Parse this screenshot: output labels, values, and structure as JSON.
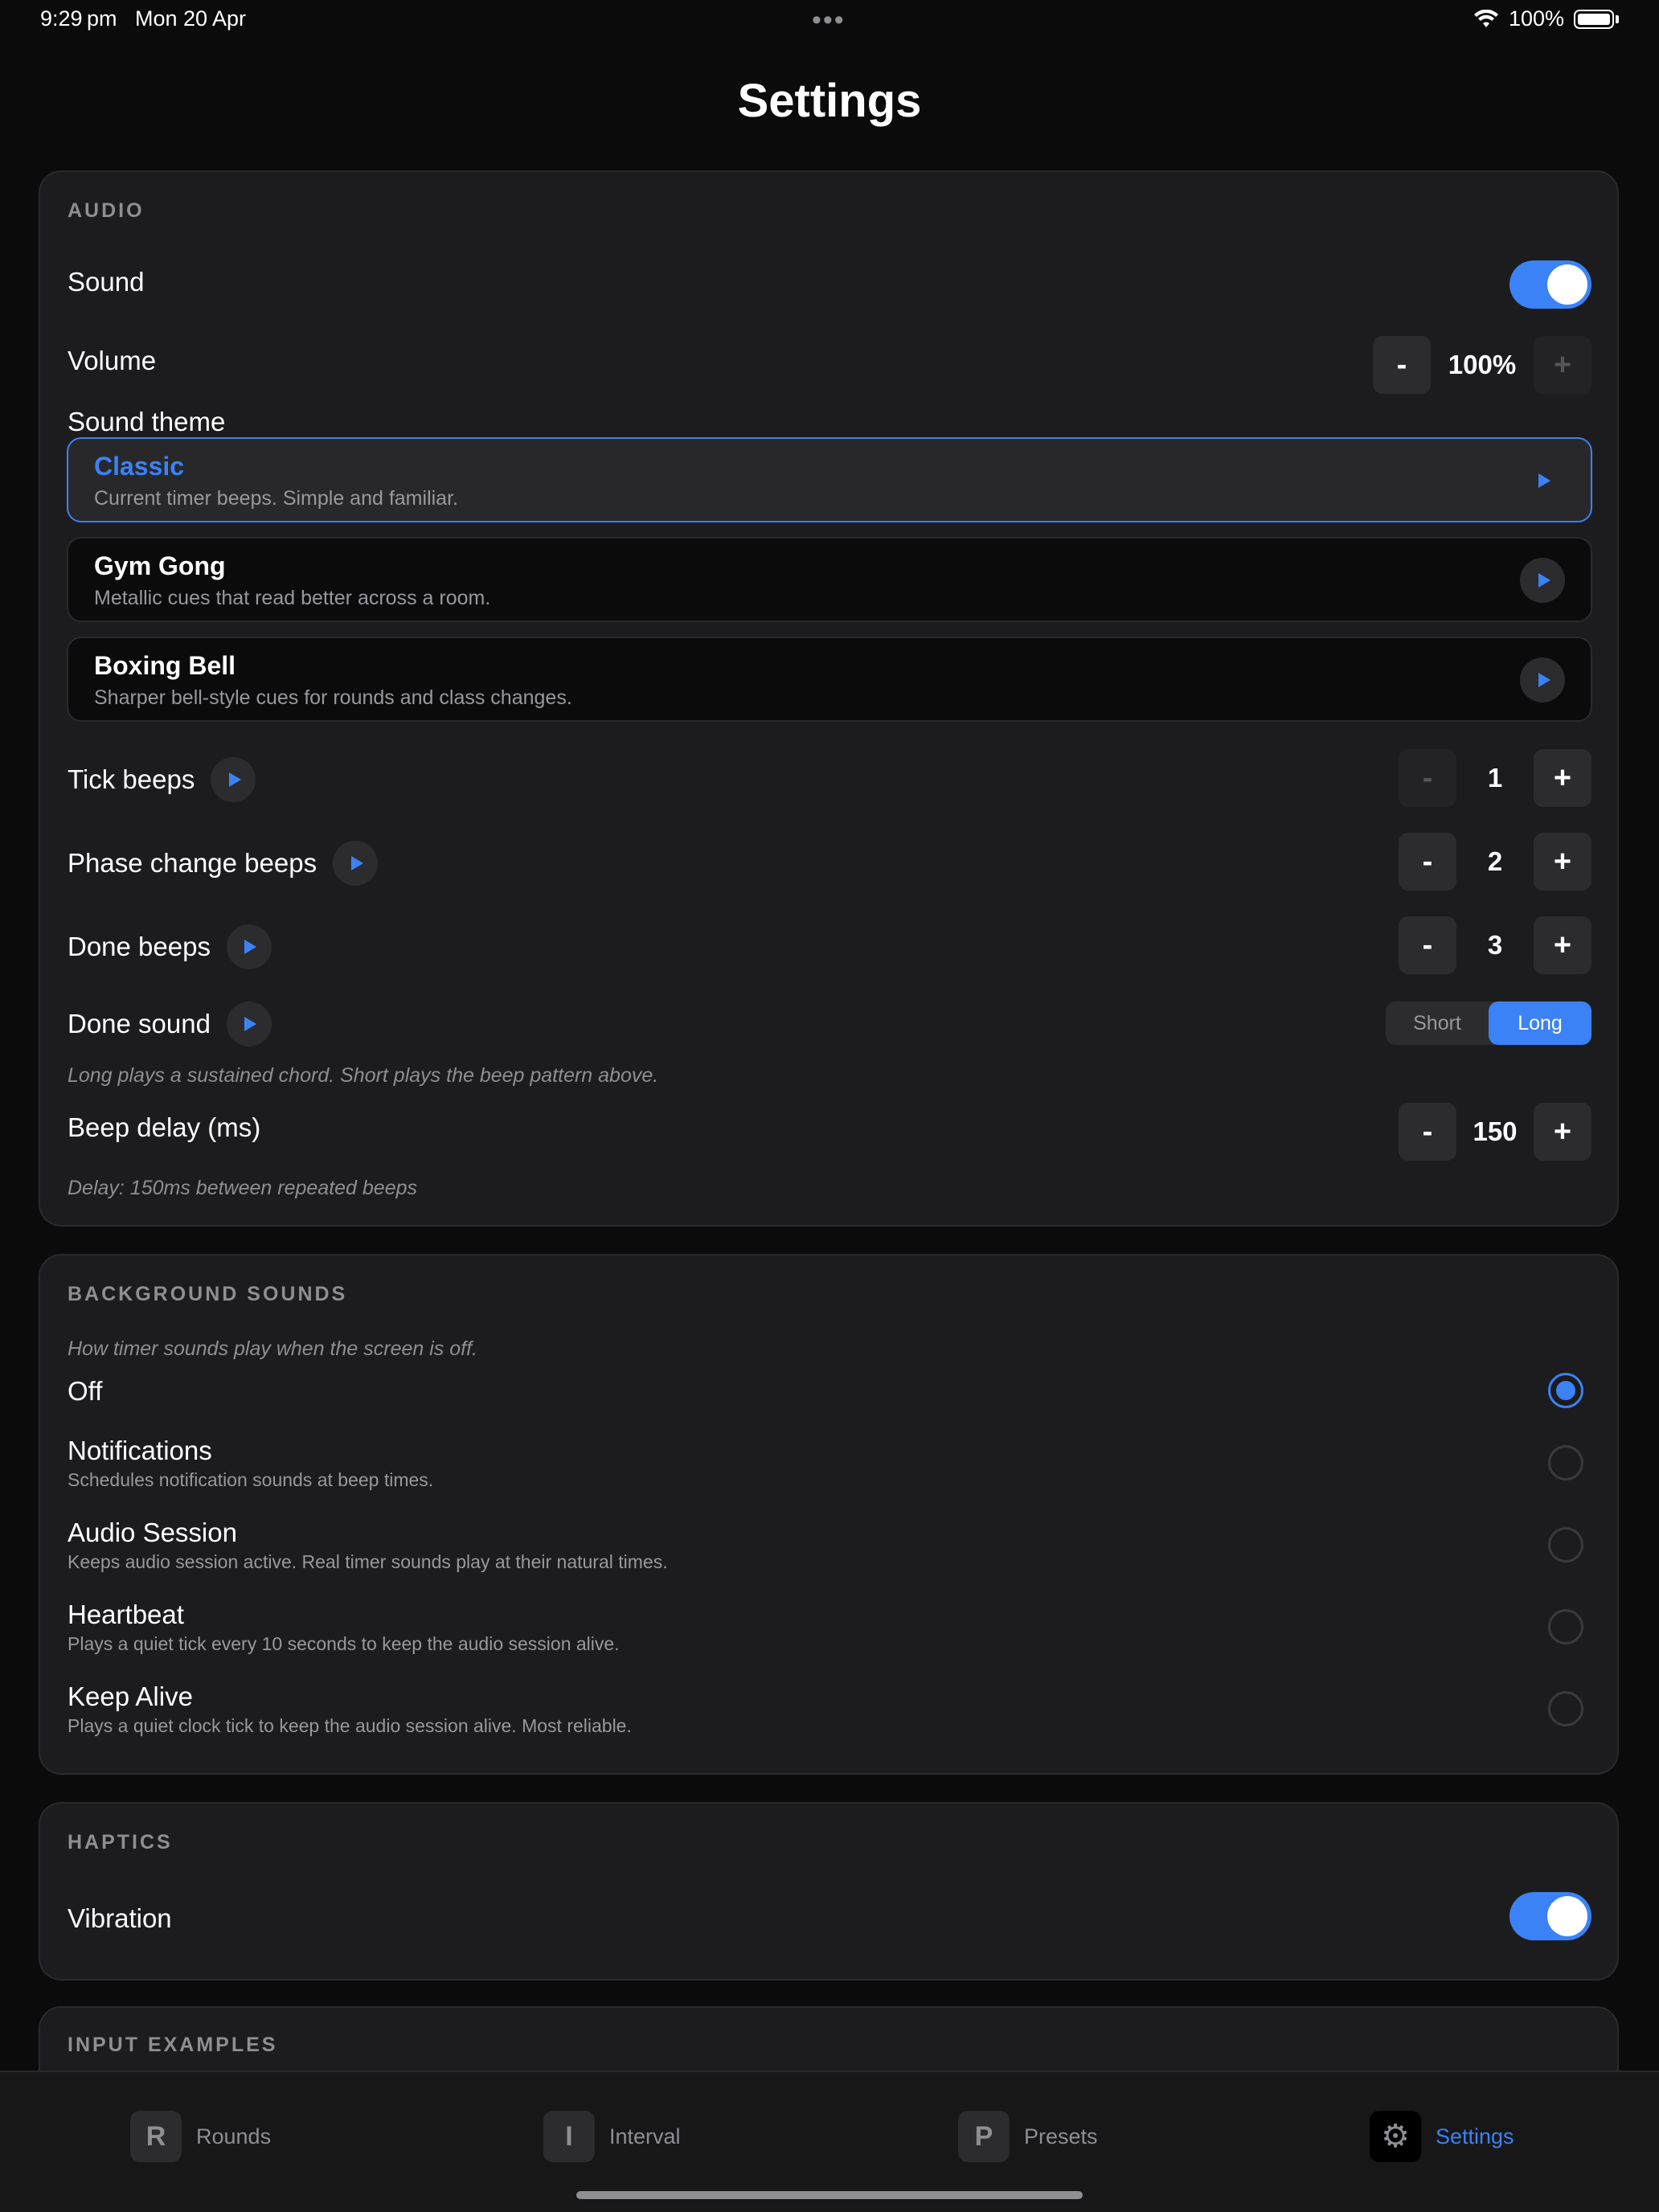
{
  "status": {
    "time": "9:29 pm   Mon 20 Apr",
    "battery": "100%"
  },
  "page": {
    "title": "Settings"
  },
  "audio": {
    "section_title": "AUDIO",
    "sound_label": "Sound",
    "sound_on": true,
    "volume_label": "Volume",
    "volume_value": "100%",
    "theme_label": "Sound theme",
    "themes": [
      {
        "name": "Classic",
        "desc": "Current timer beeps. Simple and familiar.",
        "selected": true
      },
      {
        "name": "Gym Gong",
        "desc": "Metallic cues that read better across a room.",
        "selected": false
      },
      {
        "name": "Boxing Bell",
        "desc": "Sharper bell-style cues for rounds and class changes.",
        "selected": false
      }
    ],
    "tick_label": "Tick beeps",
    "tick_value": "1",
    "phase_label": "Phase change beeps",
    "phase_value": "2",
    "done_label": "Done beeps",
    "done_value": "3",
    "done_sound_label": "Done sound",
    "done_sound_options": [
      "Short",
      "Long"
    ],
    "done_sound_selected": "Long",
    "done_sound_hint": "Long plays a sustained chord. Short plays the beep pattern above.",
    "delay_label": "Beep delay (ms)",
    "delay_value": "150",
    "delay_hint": "Delay: 150ms between repeated beeps",
    "minus": "-",
    "plus": "+"
  },
  "background": {
    "section_title": "BACKGROUND SOUNDS",
    "hint": "How timer sounds play when the screen is off.",
    "options": [
      {
        "title": "Off",
        "sub": "",
        "selected": true
      },
      {
        "title": "Notifications",
        "sub": "Schedules notification sounds at beep times.",
        "selected": false
      },
      {
        "title": "Audio Session",
        "sub": "Keeps audio session active. Real timer sounds play at their natural times.",
        "selected": false
      },
      {
        "title": "Heartbeat",
        "sub": "Plays a quiet tick every 10 seconds to keep the audio session alive.",
        "selected": false
      },
      {
        "title": "Keep Alive",
        "sub": "Plays a quiet clock tick to keep the audio session alive. Most reliable.",
        "selected": false
      }
    ]
  },
  "haptics": {
    "section_title": "HAPTICS",
    "vibration_label": "Vibration",
    "vibration_on": true
  },
  "input_examples": {
    "section_title": "INPUT EXAMPLES"
  },
  "tabs": [
    {
      "icon": "R",
      "label": "Rounds"
    },
    {
      "icon": "I",
      "label": "Interval"
    },
    {
      "icon": "P",
      "label": "Presets"
    },
    {
      "icon": "⚙",
      "label": "Settings",
      "active": true
    }
  ],
  "colors": {
    "accent": "#3b82f6",
    "background": "#0b0b0c",
    "card": "#1c1c1e"
  }
}
